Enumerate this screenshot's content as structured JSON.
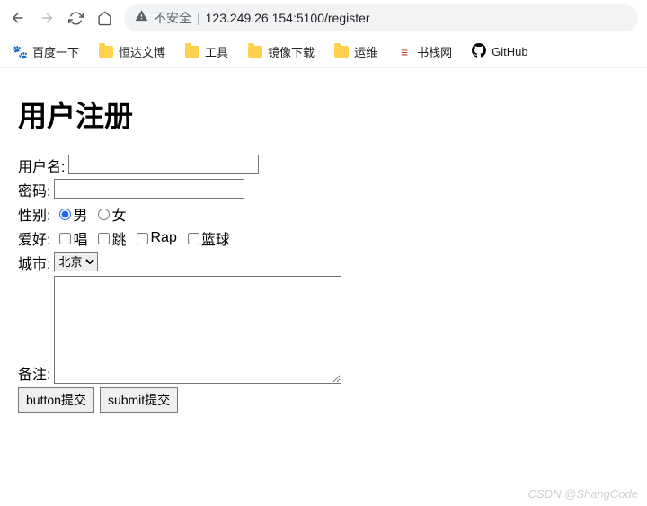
{
  "browser": {
    "security_label": "不安全",
    "url": "123.249.26.154:5100/register"
  },
  "bookmarks": {
    "baidu": "百度一下",
    "hengda": "恒达文博",
    "gongju": "工具",
    "jingxiang": "镜像下载",
    "yunwei": "运维",
    "shuzhan": "书栈网",
    "github": "GitHub"
  },
  "page": {
    "title": "用户注册",
    "username_label": "用户名:",
    "password_label": "密码:",
    "gender_label": "性别:",
    "gender_male": "男",
    "gender_female": "女",
    "hobby_label": "爱好:",
    "hobby_sing": "唱",
    "hobby_jump": "跳",
    "hobby_rap": "Rap",
    "hobby_basketball": "篮球",
    "city_label": "城市:",
    "city_selected": "北京",
    "remarks_label": "备注:",
    "button_submit": "button提交",
    "submit_submit": "submit提交"
  },
  "watermark": "CSDN @ShangCode"
}
